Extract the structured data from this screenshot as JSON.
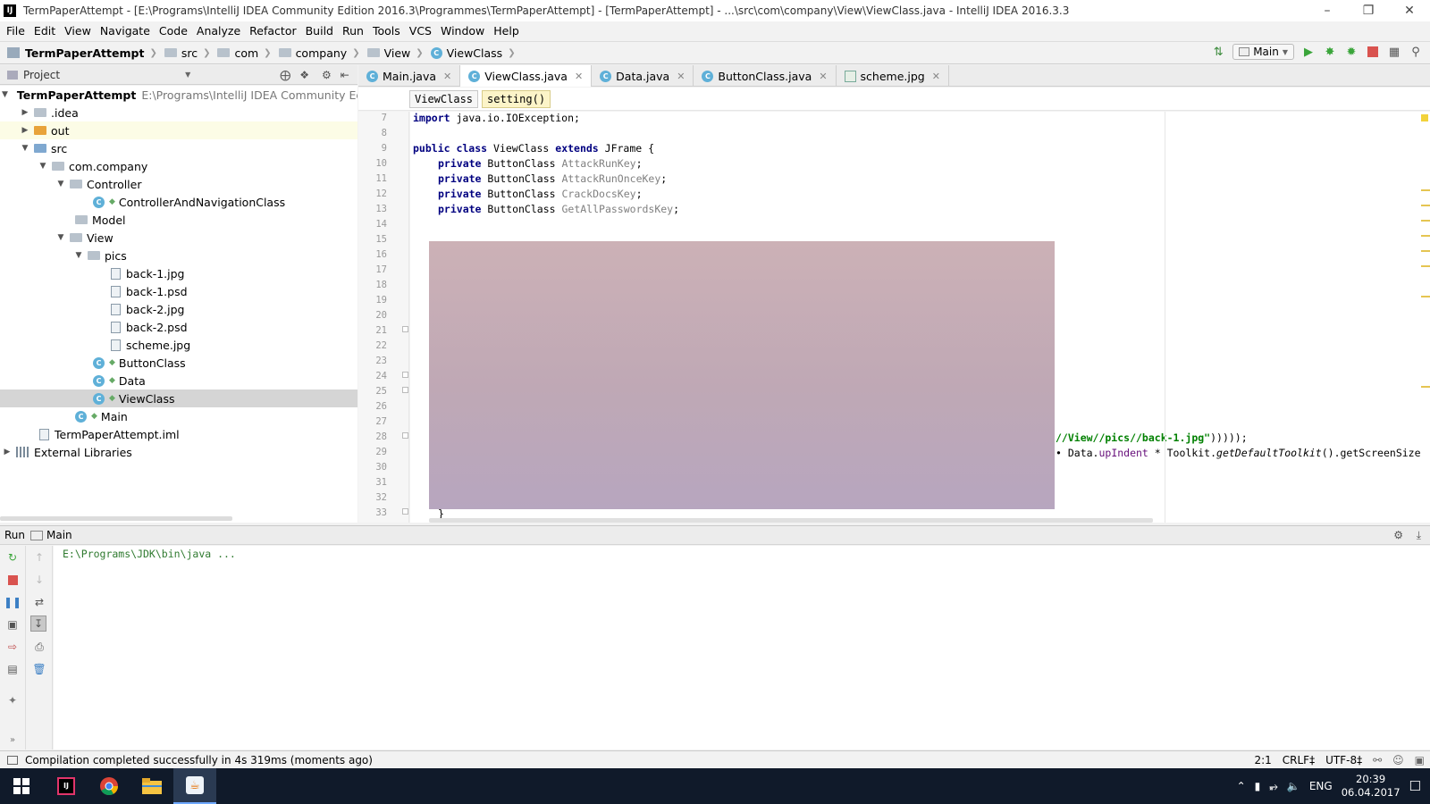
{
  "window": {
    "title": "TermPaperAttempt - [E:\\Programs\\IntelliJ IDEA Community Edition 2016.3\\Programmes\\TermPaperAttempt] - [TermPaperAttempt] - ...\\src\\com\\company\\View\\ViewClass.java - IntelliJ IDEA 2016.3.3",
    "app_icon": "IJ"
  },
  "menu": [
    "File",
    "Edit",
    "View",
    "Navigate",
    "Code",
    "Analyze",
    "Refactor",
    "Build",
    "Run",
    "Tools",
    "VCS",
    "Window",
    "Help"
  ],
  "navbar": {
    "crumbs": [
      "TermPaperAttempt",
      "src",
      "com",
      "company",
      "View",
      "ViewClass"
    ],
    "run_config": "Main"
  },
  "project_panel": {
    "label": "Project",
    "root_path": "E:\\Programs\\IntelliJ IDEA Community Edition",
    "tree": [
      {
        "label": "TermPaperAttempt",
        "kind": "module"
      },
      {
        "label": ".idea",
        "kind": "folder"
      },
      {
        "label": "out",
        "kind": "folder-orange"
      },
      {
        "label": "src",
        "kind": "folder"
      },
      {
        "label": "com.company",
        "kind": "package"
      },
      {
        "label": "Controller",
        "kind": "package"
      },
      {
        "label": "ControllerAndNavigationClass",
        "kind": "class"
      },
      {
        "label": "Model",
        "kind": "package"
      },
      {
        "label": "View",
        "kind": "package"
      },
      {
        "label": "pics",
        "kind": "package"
      },
      {
        "label": "back-1.jpg",
        "kind": "file"
      },
      {
        "label": "back-1.psd",
        "kind": "file"
      },
      {
        "label": "back-2.jpg",
        "kind": "file"
      },
      {
        "label": "back-2.psd",
        "kind": "file"
      },
      {
        "label": "scheme.jpg",
        "kind": "file"
      },
      {
        "label": "ButtonClass",
        "kind": "class"
      },
      {
        "label": "Data",
        "kind": "class"
      },
      {
        "label": "ViewClass",
        "kind": "class",
        "selected": true
      },
      {
        "label": "Main",
        "kind": "class"
      },
      {
        "label": "TermPaperAttempt.iml",
        "kind": "file"
      },
      {
        "label": "External Libraries",
        "kind": "library"
      }
    ]
  },
  "editor": {
    "tabs": [
      {
        "label": "Main.java",
        "icon": "class-icon"
      },
      {
        "label": "ViewClass.java",
        "icon": "class-icon",
        "active": true
      },
      {
        "label": "Data.java",
        "icon": "class-icon"
      },
      {
        "label": "ButtonClass.java",
        "icon": "class-icon"
      },
      {
        "label": "scheme.jpg",
        "icon": "image-icon"
      }
    ],
    "breadcrumbs": [
      "ViewClass",
      "setting()"
    ],
    "line_numbers": [
      "7",
      "8",
      "9",
      "10",
      "11",
      "12",
      "13",
      "14",
      "15",
      "16",
      "17",
      "18",
      "19",
      "20",
      "21",
      "22",
      "23",
      "24",
      "25",
      "26",
      "27",
      "28",
      "29",
      "30",
      "31",
      "32",
      "33"
    ],
    "code": {
      "l7_kw": "import",
      "l7_rest": " java.io.IOException;",
      "l9_kw": "public class",
      "l9_name": " ViewClass ",
      "l9_kw2": "extends",
      "l9_rest": " JFrame {",
      "f10_kw": "private",
      "f10_type": " ButtonClass ",
      "f10_name": "AttackRunKey",
      "f11_name": "AttackRunOnceKey",
      "f12_name": "CrackDocsKey",
      "f13_name": "GetAllPasswordsKey",
      "semi": ";",
      "l28_str": "//View//pics//back-1.jpg\"",
      "l28_rest": ")))));",
      "l29_field": "upIndent",
      "l29_a": "• Data.",
      "l29_b": " * Toolkit.",
      "l29_c": "getDefaultToolkit",
      "l29_d": "().getScreenSize(",
      "l33": "}"
    }
  },
  "run_panel": {
    "label": "Run",
    "config": "Main",
    "console_line": "E:\\Programs\\JDK\\bin\\java ..."
  },
  "status_bar": {
    "message": "Compilation completed successfully in 4s 319ms (moments ago)",
    "position": "2:1",
    "line_sep": "CRLF‡",
    "encoding": "UTF-8‡"
  },
  "taskbar": {
    "language": "ENG",
    "time": "20:39",
    "date": "06.04.2017"
  },
  "colors": {
    "accent_active_tab": "#ffffff",
    "keyword": "#000080",
    "string": "#008000",
    "field": "#660e7a",
    "taskbar": "#101a2a"
  }
}
